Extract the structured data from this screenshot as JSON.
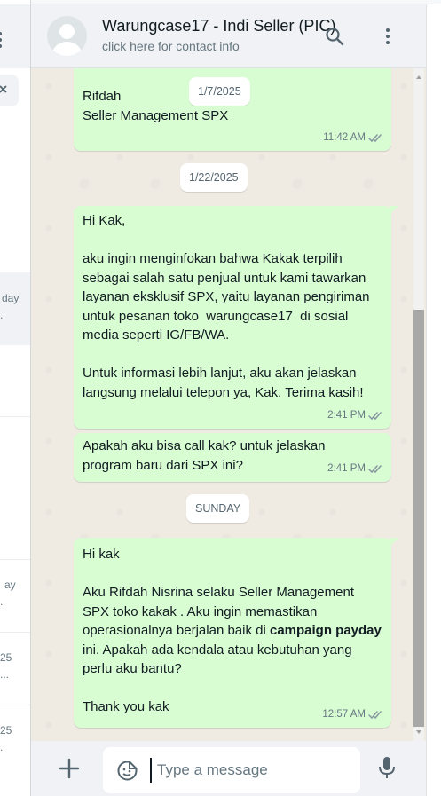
{
  "sidebar": {
    "chats": [
      {
        "time": "day",
        "preview": "."
      },
      {
        "time": "ay",
        "preview": "."
      },
      {
        "time": "25",
        "preview": "..."
      },
      {
        "time": "25",
        "preview": "."
      }
    ]
  },
  "header": {
    "contact_name": "Warungcase17 - Indi Seller (PIC)",
    "subtitle": "click here for contact info"
  },
  "messages": [
    {
      "type": "date",
      "label": "1/7/2025"
    },
    {
      "type": "out",
      "text": "Rifdah\nSeller Management SPX",
      "time": "11:42 AM"
    },
    {
      "type": "date",
      "label": "1/22/2025"
    },
    {
      "type": "out",
      "text": "Hi Kak,\n\naku ingin menginfokan bahwa Kakak terpilih sebagai salah satu penjual untuk kami tawarkan layanan eksklusif SPX, yaitu layanan pengiriman untuk pesanan toko  warungcase17  di sosial media seperti IG/FB/WA.\n\nUntuk informasi lebih lanjut, aku akan jelaskan langsung melalui telepon ya, Kak. Terima kasih!",
      "time": "2:41 PM"
    },
    {
      "type": "out",
      "text": "Apakah aku bisa call kak? untuk jelaskan program baru dari SPX ini?",
      "time": "2:41 PM"
    },
    {
      "type": "date",
      "label": "SUNDAY"
    },
    {
      "type": "out",
      "text_parts": [
        "Hi kak\n\nAku Rifdah Nisrina selaku Seller Management SPX toko kakak . Aku ingin memastikan operasionalnya berjalan baik di ",
        "campaign payday",
        " ini. Apakah ada kendala atau kebutuhan yang perlu aku bantu?\n\nThank you kak"
      ],
      "time": "12:57 AM"
    }
  ],
  "composer": {
    "placeholder": "Type a message",
    "value": ""
  },
  "colors": {
    "outgoing_bubble": "#d9fdd3",
    "chat_background": "#efeae2",
    "panel": "#f0f2f5",
    "read_tick": "#8696a0"
  },
  "icons": [
    "menu-icon",
    "close-icon",
    "search-icon",
    "more-options-icon",
    "double-check-icon",
    "plus-icon",
    "sticker-icon",
    "microphone-icon"
  ]
}
